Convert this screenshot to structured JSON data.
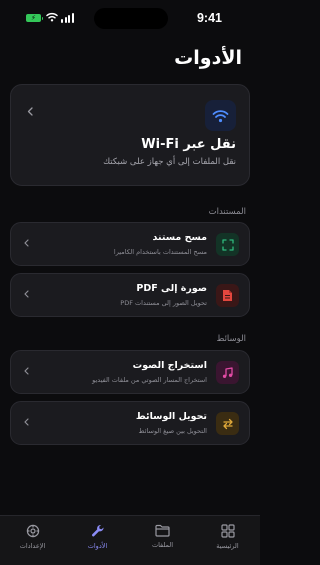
{
  "status_bar": {
    "time": "9:41"
  },
  "header": {
    "title": "الأدوات"
  },
  "hero": {
    "title": "نقل عبر Wi-Fi",
    "subtitle": "نقل الملفات إلى أي جهاز على شبكتك",
    "icon": "wifi-icon"
  },
  "sections": [
    {
      "label": "المستندات",
      "items": [
        {
          "title": "مسح مستند",
          "subtitle": "مسح المستندات باستخدام الكاميرا",
          "icon": "scan-icon",
          "color": "#2fb97d"
        },
        {
          "title": "صورة إلى PDF",
          "subtitle": "تحويل الصور إلى مستندات PDF",
          "icon": "pdf-icon",
          "color": "#e3473e"
        }
      ]
    },
    {
      "label": "الوسائط",
      "items": [
        {
          "title": "استخراج الصوت",
          "subtitle": "استخراج المسار الصوتي من ملفات الفيديو",
          "icon": "music-icon",
          "color": "#e24ba5"
        },
        {
          "title": "تحويل الوسائط",
          "subtitle": "التحويل بين صيغ الوسائط",
          "icon": "convert-icon",
          "color": "#e0a93a"
        }
      ]
    }
  ],
  "tab_bar": {
    "tabs": [
      {
        "label": "الرئيسية",
        "icon": "grid-icon"
      },
      {
        "label": "الملفات",
        "icon": "folder-icon"
      },
      {
        "label": "الأدوات",
        "icon": "wrench-icon",
        "active": true
      },
      {
        "label": "الإعدادات",
        "icon": "gear-icon"
      }
    ]
  }
}
